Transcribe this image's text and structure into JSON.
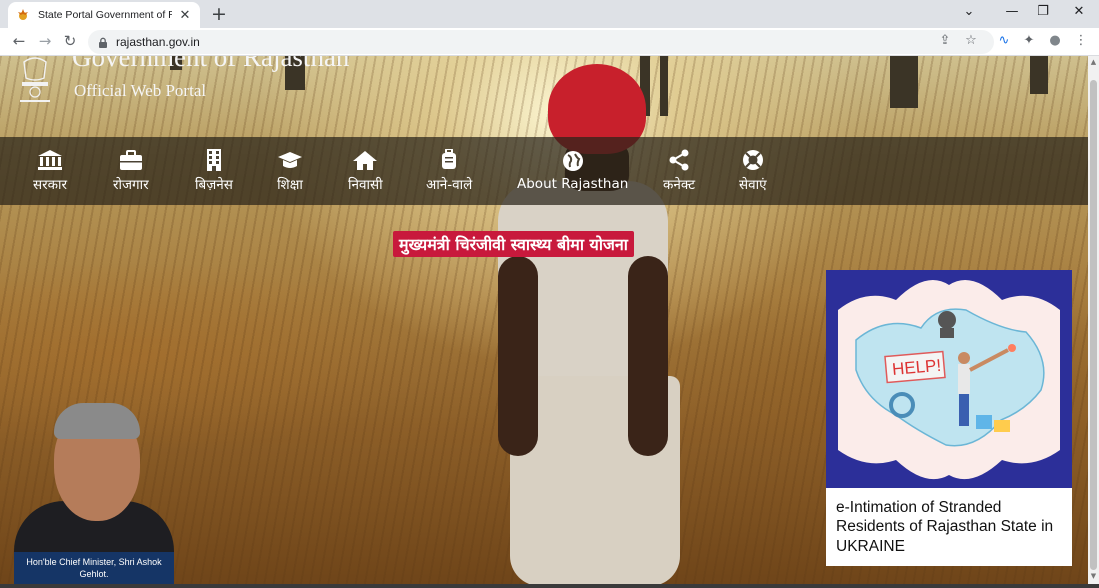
{
  "browser": {
    "tab_title": "State Portal Government of Rajasthan",
    "tab_close": "✕",
    "new_tab": "+",
    "url": "rajasthan.gov.in",
    "win_controls": {
      "dropdown": "⌄",
      "minimize": "—",
      "restore": "❐",
      "close": "✕"
    },
    "nav": {
      "back": "←",
      "forward": "→",
      "reload": "↻"
    },
    "toolbar_icons": {
      "share": "⇪",
      "star": "☆",
      "extension_a": "∿",
      "puzzle": "✦",
      "profile": "●",
      "menu": "⋮"
    }
  },
  "header": {
    "title": "Government of Rajasthan",
    "subtitle": "Official Web Portal"
  },
  "navbar": {
    "items": [
      {
        "label": "सरकार",
        "icon": "bank-icon"
      },
      {
        "label": "रोजगार",
        "icon": "briefcase-icon"
      },
      {
        "label": "बिज़नेस",
        "icon": "building-icon"
      },
      {
        "label": "शिक्षा",
        "icon": "graduation-cap-icon"
      },
      {
        "label": "निवासी",
        "icon": "home-icon"
      },
      {
        "label": "आने-वाले",
        "icon": "luggage-icon"
      },
      {
        "label": "About Rajasthan",
        "icon": "globe-icon"
      },
      {
        "label": "कनेक्ट",
        "icon": "share-icon"
      },
      {
        "label": "सेवाएं",
        "icon": "lifebuoy-icon"
      }
    ]
  },
  "banner": {
    "text": "मुख्यमंत्री चिरंजीवी स्वास्थ्य बीमा योजना"
  },
  "cm": {
    "caption": "Hon'ble Chief Minister, Shri Ashok Gehlot."
  },
  "card": {
    "image_text": "HELP!",
    "text": "e-Intimation of Stranded Residents of Rajasthan State in UKRAINE"
  }
}
